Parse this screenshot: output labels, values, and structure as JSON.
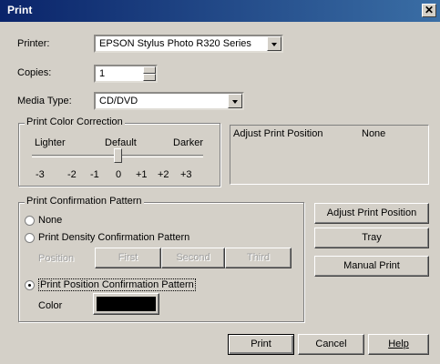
{
  "window": {
    "title": "Print",
    "close_glyph": "✕"
  },
  "printer": {
    "label": "Printer:",
    "value": "EPSON Stylus Photo R320 Series"
  },
  "copies": {
    "label": "Copies:",
    "value": "1"
  },
  "media": {
    "label": "Media Type:",
    "value": "CD/DVD"
  },
  "color_correction": {
    "title": "Print Color Correction",
    "lighter": "Lighter",
    "default": "Default",
    "darker": "Darker",
    "scale": [
      "-3",
      "-2",
      "-1",
      "0",
      "+1",
      "+2",
      "+3"
    ],
    "selected": "0"
  },
  "position_panel": {
    "label": "Adjust Print Position",
    "value": "None"
  },
  "confirmation": {
    "title": "Print Confirmation Pattern",
    "opt_none": "None",
    "opt_density": "Print Density Confirmation Pattern",
    "position_label": "Position",
    "first": "First",
    "second": "Second",
    "third": "Third",
    "opt_position": "Print Position Confirmation Pattern",
    "color_label": "Color",
    "color_value": "#000000",
    "selected": "opt_position"
  },
  "side_buttons": {
    "adjust": "Adjust Print Position",
    "tray": "Tray",
    "manual": "Manual Print"
  },
  "footer": {
    "print": "Print",
    "cancel": "Cancel",
    "help": "Help"
  },
  "colors": {
    "title_bar_start": "#0a246a",
    "title_bar_end": "#3a6ea5",
    "face": "#d4d0c8"
  }
}
